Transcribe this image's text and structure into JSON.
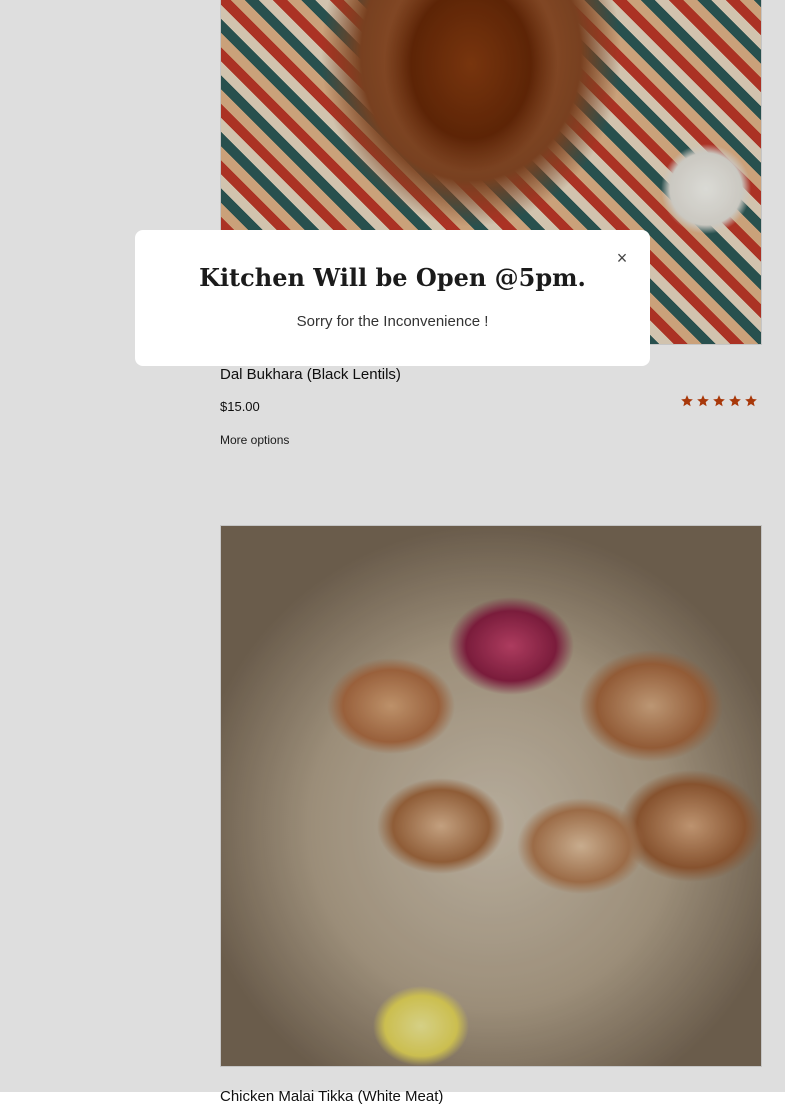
{
  "products": [
    {
      "title": "Dal Bukhara (Black Lentils)",
      "price": "$15.00",
      "rating": 5,
      "rating_color": "#c2410c",
      "more_options_label": "More options"
    },
    {
      "title": "Chicken Malai Tikka (White Meat)"
    }
  ],
  "modal": {
    "title": "Kitchen Will be Open @5pm.",
    "message": "Sorry for the Inconvenience !",
    "close_icon": "×"
  }
}
